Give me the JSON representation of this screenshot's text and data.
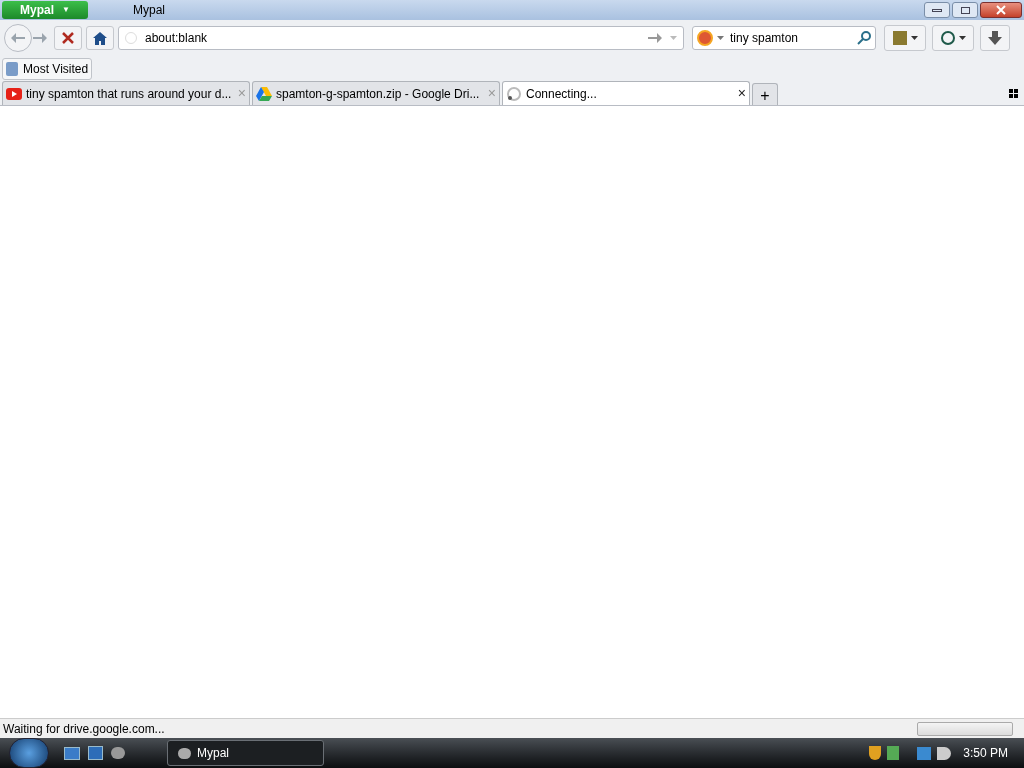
{
  "app_menu": {
    "label": "Mypal",
    "caret": "▼"
  },
  "window": {
    "title": "Mypal"
  },
  "address_bar": {
    "value": "about:blank"
  },
  "search_bar": {
    "value": "tiny spamton"
  },
  "bookmarks": [
    {
      "label": "Most Visited"
    }
  ],
  "tabs": [
    {
      "label": "tiny spamton that runs around your d...",
      "kind": "video",
      "selected": false,
      "close": "×"
    },
    {
      "label": "spamton-g-spamton.zip - Google Dri...",
      "kind": "drive",
      "selected": false,
      "close": "×"
    },
    {
      "label": "Connecting...",
      "kind": "loading",
      "selected": true,
      "close": "×"
    }
  ],
  "new_tab": "+",
  "status_bar": {
    "text": "Waiting for drive.google.com...",
    "progress": {
      "level": 0
    }
  },
  "taskbar": {
    "tasks": [
      {
        "label": "Mypal",
        "selected": true
      }
    ],
    "clock": "3:50 PM"
  }
}
